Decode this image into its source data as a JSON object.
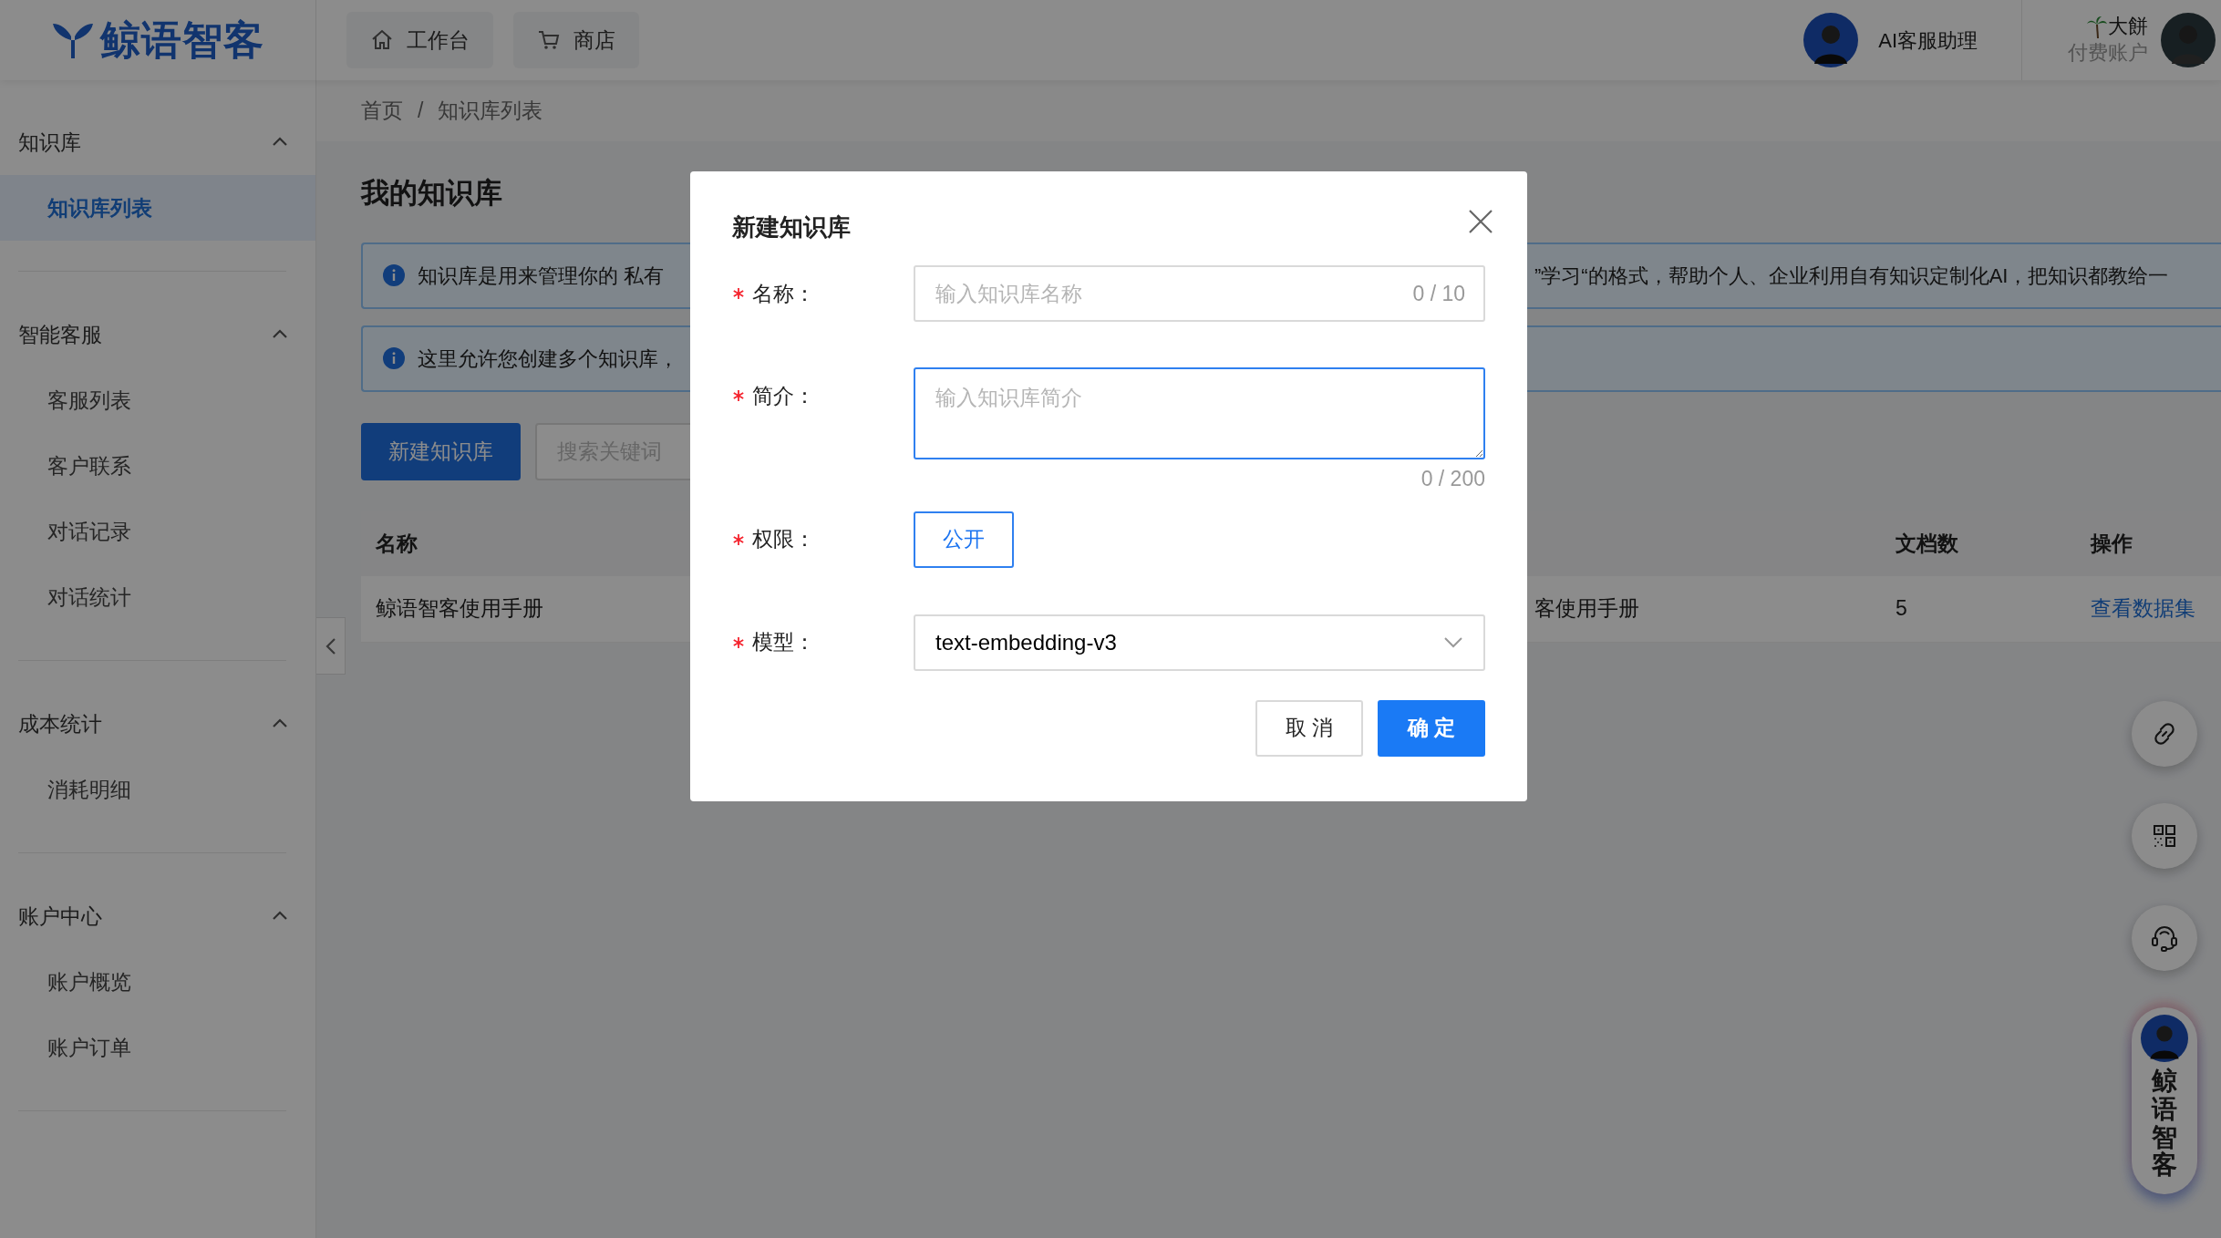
{
  "header": {
    "logo": "鲸语智客",
    "nav": [
      {
        "label": "工作台"
      },
      {
        "label": "商店"
      }
    ],
    "assistant": {
      "name": "AI客服助理"
    },
    "user": {
      "name": "大餅",
      "plan": "付费账户"
    }
  },
  "sidebar": {
    "groups": [
      {
        "title": "知识库",
        "expanded": true,
        "items": [
          {
            "label": "知识库列表",
            "selected": true
          }
        ]
      },
      {
        "title": "智能客服",
        "expanded": true,
        "items": [
          {
            "label": "客服列表",
            "selected": false
          },
          {
            "label": "客户联系",
            "selected": false
          },
          {
            "label": "对话记录",
            "selected": false
          },
          {
            "label": "对话统计",
            "selected": false
          }
        ]
      },
      {
        "title": "成本统计",
        "expanded": true,
        "items": [
          {
            "label": "消耗明细",
            "selected": false
          }
        ]
      },
      {
        "title": "账户中心",
        "expanded": true,
        "items": [
          {
            "label": "账户概览",
            "selected": false
          },
          {
            "label": "账户订单",
            "selected": false
          }
        ]
      }
    ]
  },
  "breadcrumb": [
    "首页",
    "知识库列表"
  ],
  "breadcrumb_separator": "/",
  "page_title": "我的知识库",
  "alerts": [
    {
      "visible_parts": [
        "知识库是用来管理你的 私有",
        "”学习“的格式，帮助个人、企业利用自有知识定制化AI，把知识都教给一"
      ]
    },
    {
      "visible_parts": [
        "这里允许您创建多个知识库，"
      ]
    }
  ],
  "toolbar": {
    "new_button": "新建知识库",
    "search": {
      "placeholder": "搜索关键词"
    }
  },
  "table": {
    "columns": [
      "名称",
      "文档数",
      "操作"
    ],
    "rows": [
      {
        "name": "鲸语智客使用手册",
        "column_2": "客使用手册",
        "docs": "5",
        "action": "查看数据集"
      }
    ]
  },
  "assistant_pill": {
    "label": "鲸语智客"
  },
  "modal": {
    "title": "新建知识库",
    "fields": [
      {
        "kind": "input",
        "label": "名称：",
        "required": true,
        "placeholder": "输入知识库名称",
        "counter": "0 / 10",
        "focused": false
      },
      {
        "kind": "textarea",
        "label": "简介：",
        "required": true,
        "placeholder": "输入知识库简介",
        "counter": "0 / 200",
        "focused": true
      },
      {
        "kind": "options",
        "label": "权限：",
        "required": true,
        "options": [
          {
            "label": "公开",
            "selected": true
          }
        ]
      },
      {
        "kind": "select",
        "label": "模型：",
        "required": true,
        "value": "text-embedding-v3"
      }
    ],
    "buttons": [
      {
        "label": "取 消",
        "primary": false
      },
      {
        "label": "确 定",
        "primary": true
      }
    ]
  }
}
